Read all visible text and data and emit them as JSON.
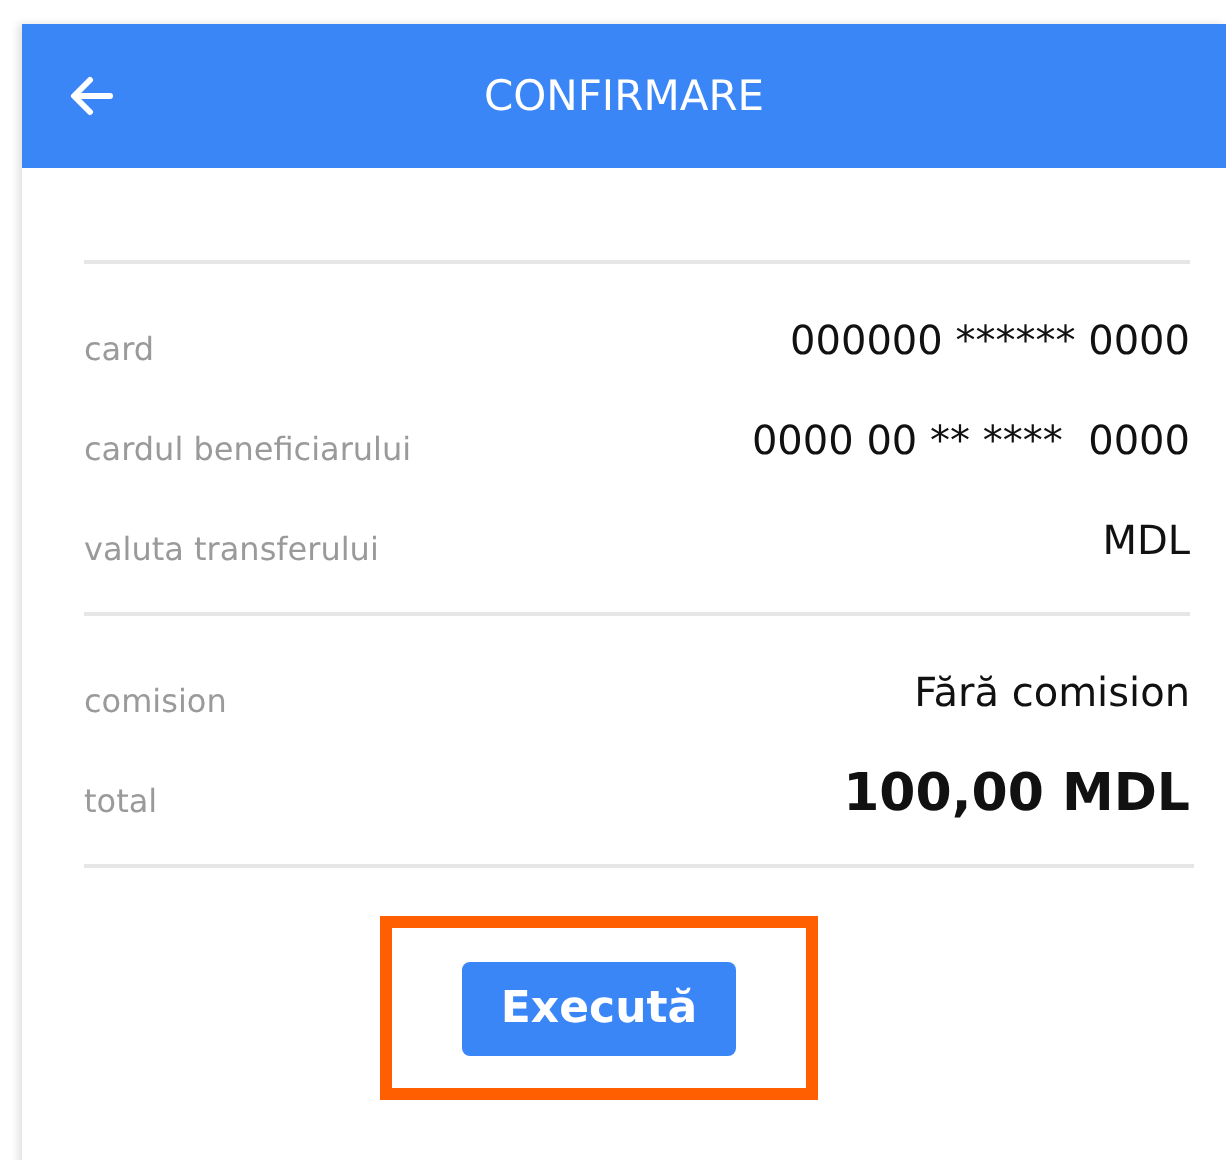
{
  "header": {
    "title": "CONFIRMARE"
  },
  "sections": [
    {
      "rows": [
        {
          "label": "card",
          "value": "000000 ****** 0000",
          "bold": false
        },
        {
          "label": "cardul beneficiarului",
          "value": "0000 00 ** ****  0000",
          "bold": false
        },
        {
          "label": "valuta transferului",
          "value": "MDL",
          "bold": false
        }
      ]
    },
    {
      "rows": [
        {
          "label": "comision",
          "value": "Fără comision",
          "bold": false
        },
        {
          "label": "total",
          "value": "100,00 MDL",
          "bold": true
        }
      ]
    }
  ],
  "button": {
    "label": "Execută",
    "highlighted": true
  }
}
